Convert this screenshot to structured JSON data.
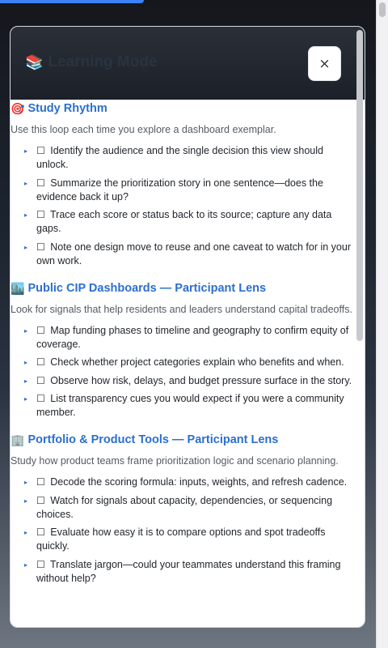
{
  "modal": {
    "title": "Learning Mode",
    "title_icon": "📚",
    "close_label": "×"
  },
  "sections": [
    {
      "emoji": "🎯",
      "title": "Study Rhythm",
      "intro": "Use this loop each time you explore a dashboard exemplar.",
      "items": [
        "Identify the audience and the single decision this view should unlock.",
        "Summarize the prioritization story in one sentence—does the evidence back it up?",
        "Trace each score or status back to its source; capture any data gaps.",
        "Note one design move to reuse and one caveat to watch for in your own work."
      ]
    },
    {
      "emoji": "🏙️",
      "title": "Public CIP Dashboards — Participant Lens",
      "intro": "Look for signals that help residents and leaders understand capital tradeoffs.",
      "items": [
        "Map funding phases to timeline and geography to confirm equity of coverage.",
        "Check whether project categories explain who benefits and when.",
        "Observe how risk, delays, and budget pressure surface in the story.",
        "List transparency cues you would expect if you were a community member."
      ]
    },
    {
      "emoji": "🏢",
      "title": "Portfolio & Product Tools — Participant Lens",
      "intro": "Study how product teams frame prioritization logic and scenario planning.",
      "items": [
        "Decode the scoring formula: inputs, weights, and refresh cadence.",
        "Watch for signals about capacity, dependencies, or sequencing choices.",
        "Evaluate how easy it is to compare options and spot tradeoffs quickly.",
        "Translate jargon—could your teammates understand this framing without help?"
      ]
    }
  ],
  "checkbox_glyph": "☐",
  "bullet_glyph": "▸"
}
